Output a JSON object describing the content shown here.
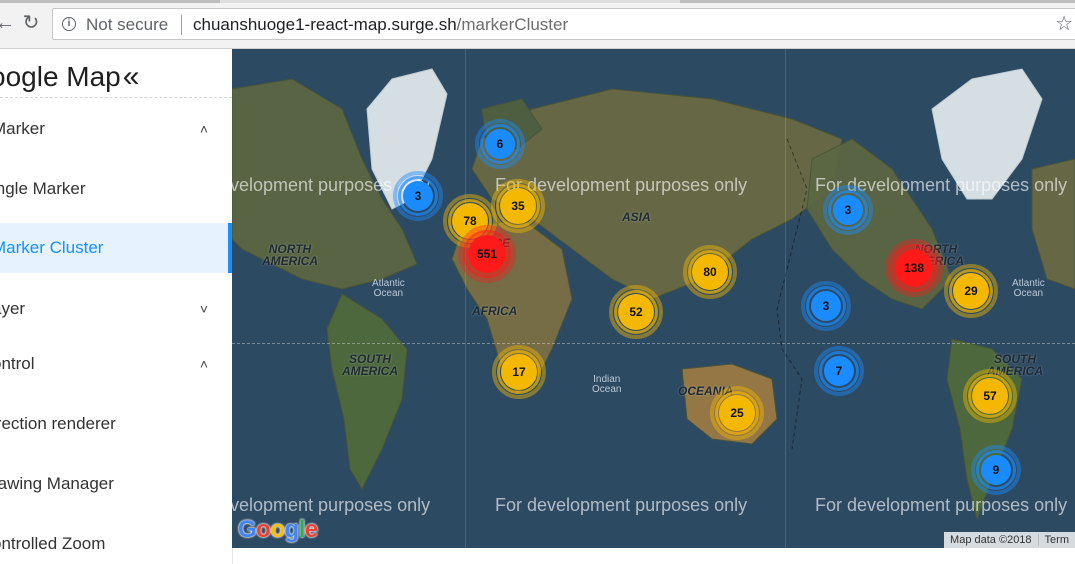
{
  "browser": {
    "security_label": "Not secure",
    "url_host": "chuanshuoge1-react-map.surge.sh",
    "url_path": "/markerCluster"
  },
  "icons": {
    "back": "back-arrow-icon",
    "reload": "reload-icon",
    "info": "info-icon",
    "star": "star-icon",
    "collapse": "double-chevron-left-icon",
    "expand": "chevron-up-icon",
    "collapsed": "chevron-down-icon"
  },
  "sidebar": {
    "title": "oogle Map",
    "items": [
      {
        "label": "Marker",
        "chevron": "˄",
        "type": "group"
      },
      {
        "label": "ingle Marker",
        "type": "sub"
      },
      {
        "label": "Marker Cluster",
        "type": "sub",
        "active": true
      },
      {
        "label": "ayer",
        "chevron": "˅",
        "type": "group"
      },
      {
        "label": "ontrol",
        "chevron": "˄",
        "type": "group"
      },
      {
        "label": "irection renderer",
        "type": "sub"
      },
      {
        "label": "rawing Manager",
        "type": "sub"
      },
      {
        "label": "ontrolled Zoom",
        "type": "sub"
      }
    ]
  },
  "map": {
    "watermark": "For development purposes only",
    "watermark_cut": "velopment purposes only",
    "regions": {
      "north_america": "NORTH\nAMERICA",
      "south_america": "SOUTH\nAMERICA",
      "africa": "AFRICA",
      "asia": "ASIA",
      "oceania": "OCEANIA",
      "europe_cut": "PE"
    },
    "oceans": {
      "atlantic": "Atlantic\nOcean",
      "indian": "Indian\nOcean"
    },
    "clusters": [
      {
        "count": "6",
        "color": "blue"
      },
      {
        "count": "3",
        "color": "blue"
      },
      {
        "count": "78",
        "color": "yellow"
      },
      {
        "count": "35",
        "color": "yellow"
      },
      {
        "count": "551",
        "color": "red"
      },
      {
        "count": "80",
        "color": "yellow"
      },
      {
        "count": "52",
        "color": "yellow"
      },
      {
        "count": "17",
        "color": "yellow"
      },
      {
        "count": "25",
        "color": "yellow"
      },
      {
        "count": "3",
        "color": "blue"
      },
      {
        "count": "138",
        "color": "red"
      },
      {
        "count": "29",
        "color": "yellow"
      },
      {
        "count": "3",
        "color": "blue"
      },
      {
        "count": "7",
        "color": "blue"
      },
      {
        "count": "57",
        "color": "yellow"
      },
      {
        "count": "9",
        "color": "blue"
      }
    ],
    "logo": "Google",
    "attribution": "Map data ©2018",
    "terms": "Term"
  },
  "colors": {
    "accent": "#1890ff",
    "cluster_blue": "#1a8cff",
    "cluster_yellow": "#f5b800",
    "cluster_red": "#ff1a1a",
    "ocean": "#2d4a63"
  }
}
